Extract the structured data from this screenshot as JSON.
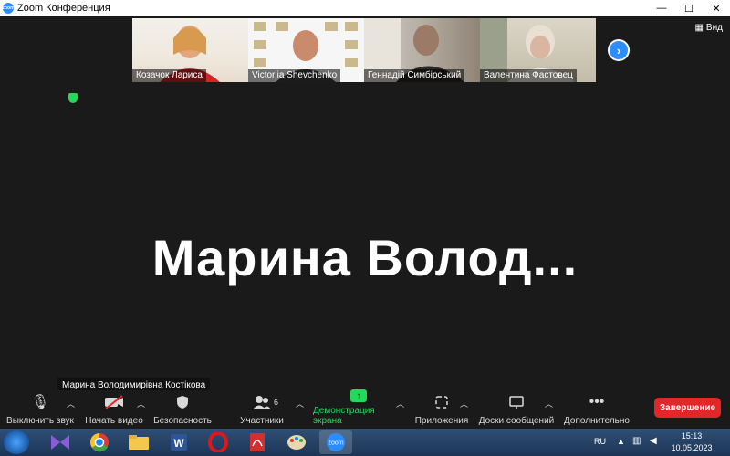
{
  "window": {
    "title": "Zoom Конференция",
    "app_icon_text": "zoom"
  },
  "participants": [
    {
      "name": "Козачок Лариса"
    },
    {
      "name": "Victoriia Shevchenko"
    },
    {
      "name": "Геннадій Симбірський"
    },
    {
      "name": "Валентина Фастовец"
    }
  ],
  "view_button": {
    "label": "Вид"
  },
  "active_speaker": {
    "display_name": "Марина  Волод...",
    "name_tag": "Марина Володимирівна Костікова"
  },
  "toolbar": {
    "mute": "Выключить звук",
    "video": "Начать видео",
    "security": "Безопасность",
    "participants": "Участники",
    "participants_count": "6",
    "share": "Демонстрация экрана",
    "apps": "Приложения",
    "whiteboards": "Доски сообщений",
    "more": "Дополнительно",
    "end": "Завершение"
  },
  "taskbar": {
    "lang": "RU",
    "time": "15:13",
    "date": "10.05.2023"
  },
  "colors": {
    "accent_blue": "#2d8cff",
    "share_green": "#23d959",
    "end_red": "#e02828"
  }
}
